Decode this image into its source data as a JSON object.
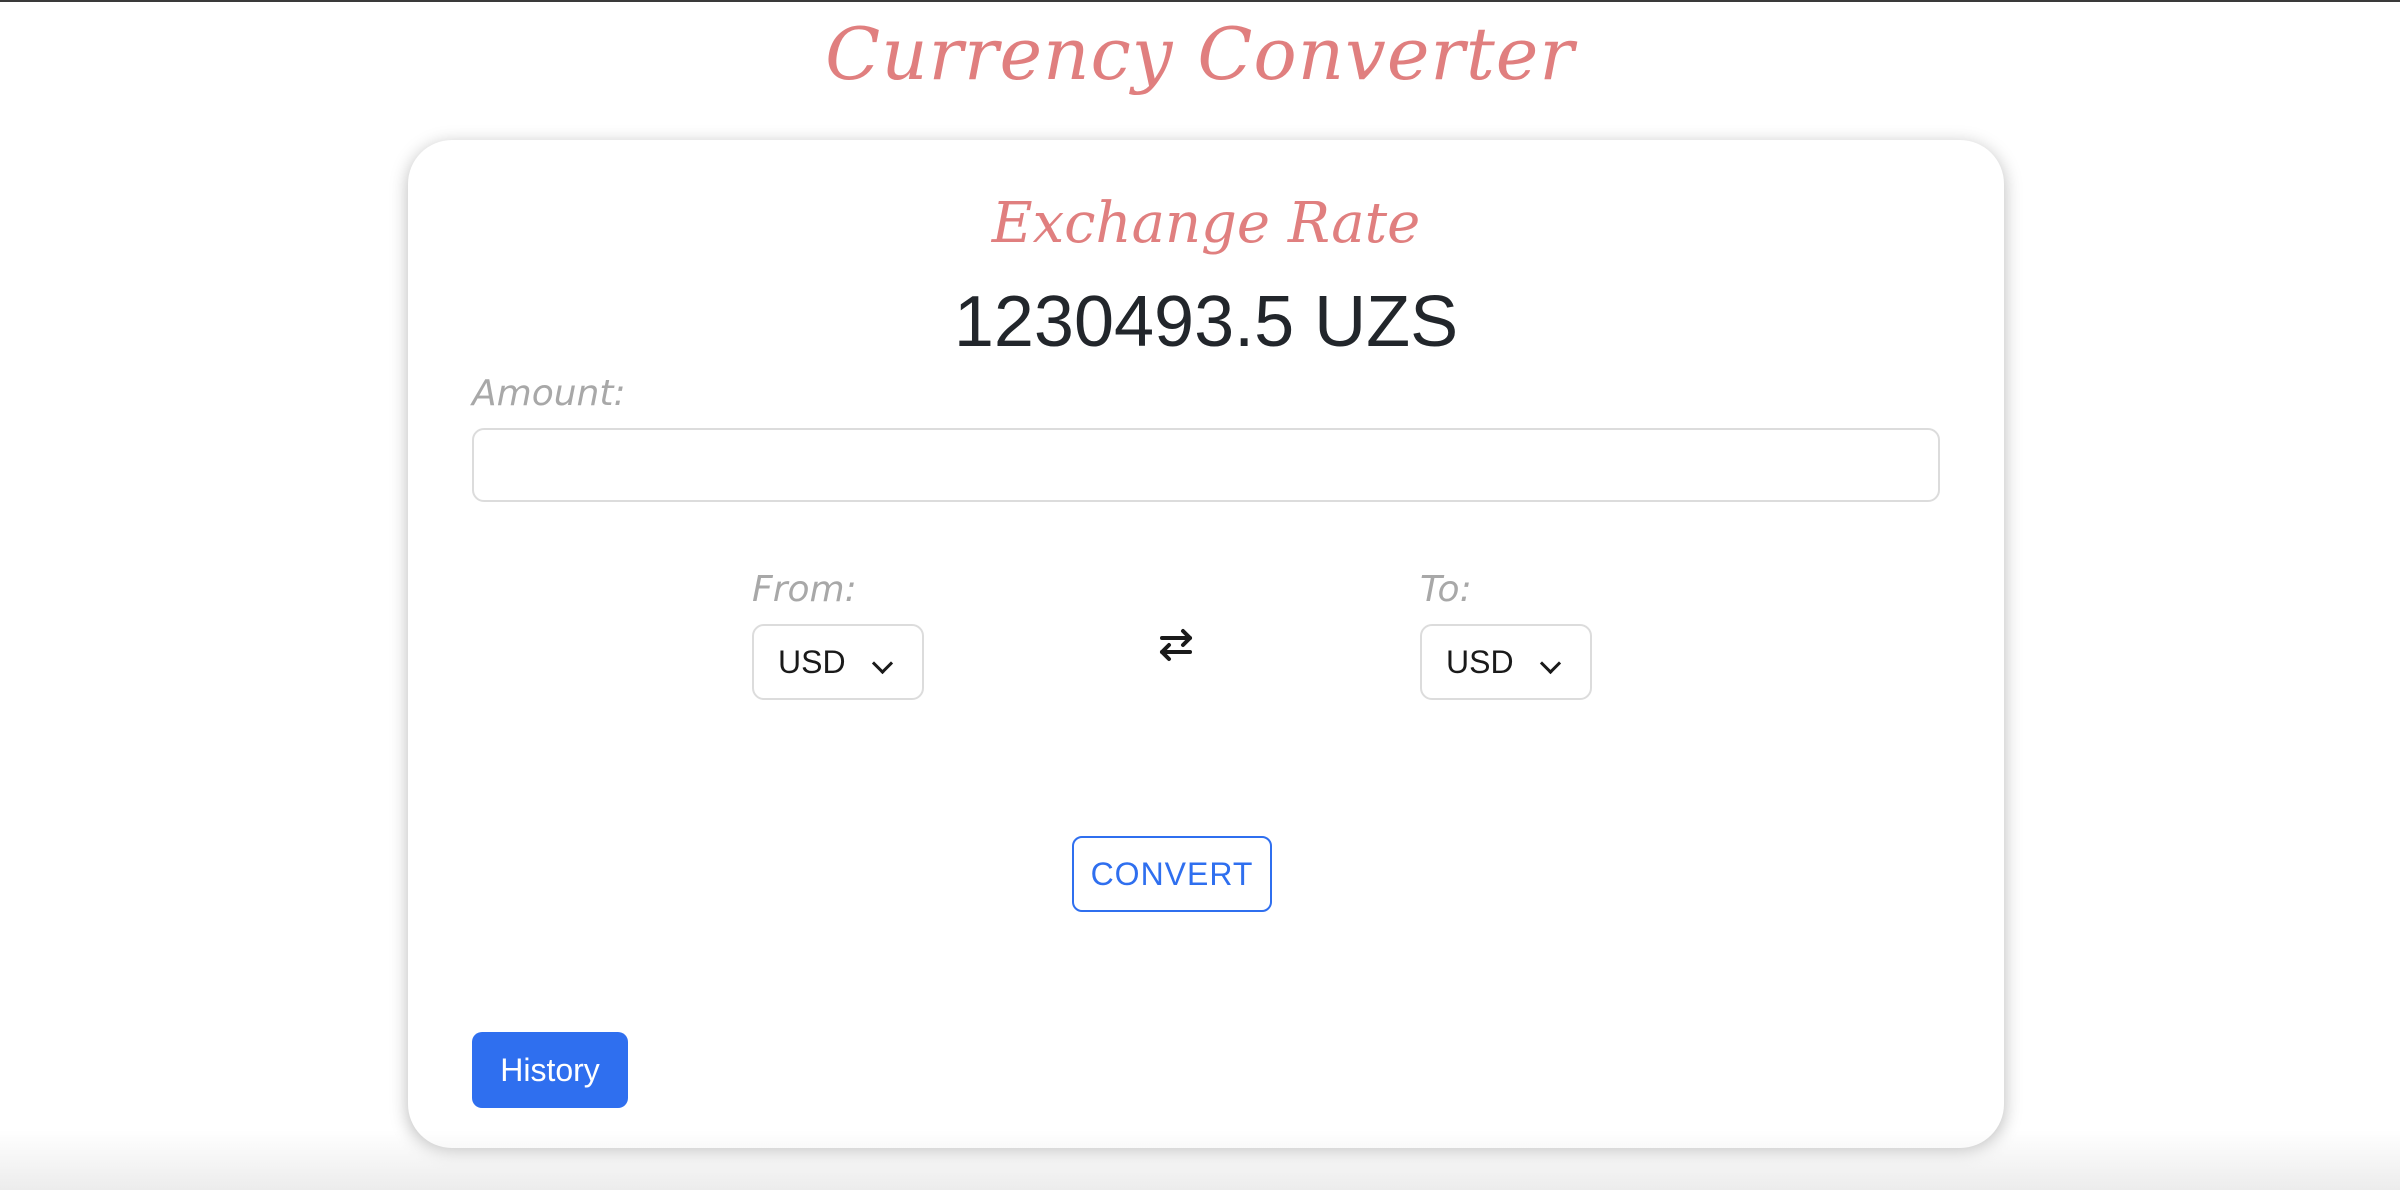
{
  "header": {
    "title": "Currency Converter"
  },
  "card": {
    "rate_title": "Exchange Rate",
    "rate_value": "1230493.5 UZS"
  },
  "amount": {
    "label": "Amount:",
    "value": "",
    "placeholder": ""
  },
  "from": {
    "label": "From:",
    "selected": "USD"
  },
  "to": {
    "label": "To:",
    "selected": "USD"
  },
  "swap": {
    "icon": "swap-arrows-icon"
  },
  "buttons": {
    "convert_label": "CONVERT",
    "history_label": "History"
  },
  "colors": {
    "title_accent": "#e07f7f",
    "primary": "#2f6fef",
    "label_gray": "#a8a8a8"
  }
}
